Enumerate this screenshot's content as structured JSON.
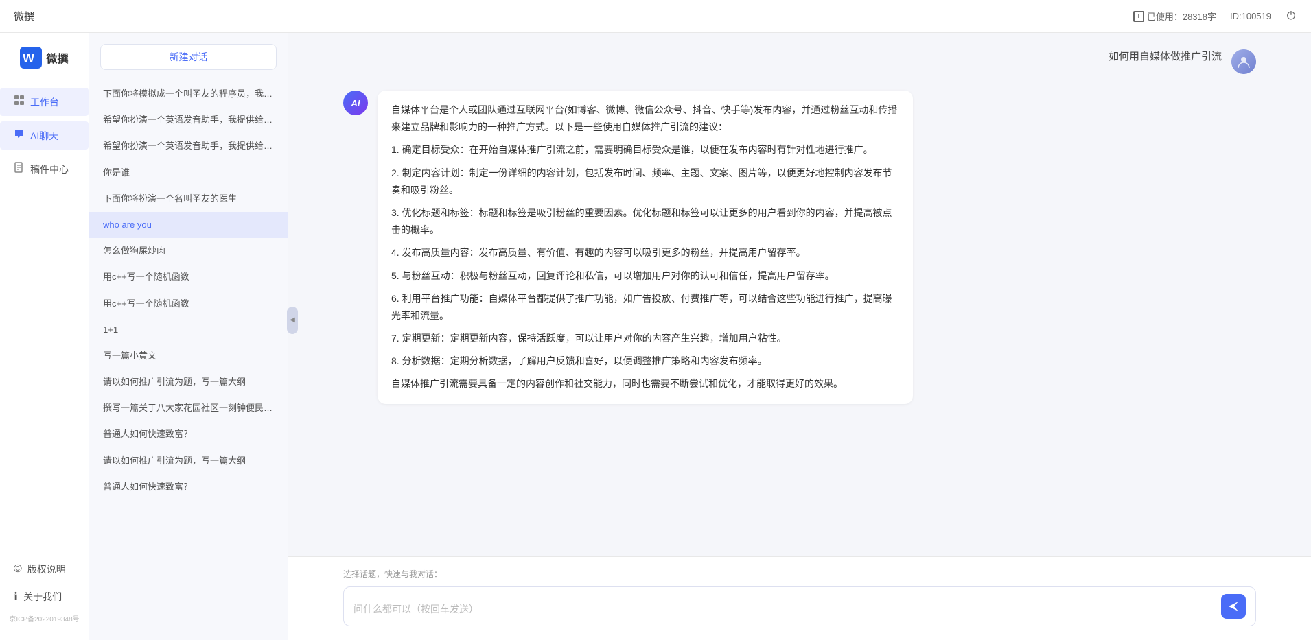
{
  "topbar": {
    "title": "微撰",
    "usage_label": "已使用：28318字",
    "id_label": "ID:100519",
    "usage_icon": "T"
  },
  "logo": {
    "text": "微撰"
  },
  "nav": {
    "items": [
      {
        "id": "workspace",
        "label": "工作台",
        "icon": "⊞"
      },
      {
        "id": "ai-chat",
        "label": "AI聊天",
        "icon": "💬",
        "active": true
      },
      {
        "id": "drafts",
        "label": "稿件中心",
        "icon": "📄"
      }
    ],
    "bottom_items": [
      {
        "id": "copyright",
        "label": "版权说明",
        "icon": "©"
      },
      {
        "id": "about",
        "label": "关于我们",
        "icon": "ℹ"
      }
    ],
    "copyright": "京ICP备2022019348号"
  },
  "sidebar": {
    "new_chat": "新建对话",
    "history": [
      {
        "id": 1,
        "text": "下面你将模拟成一个叫圣友的程序员，我说...",
        "active": false
      },
      {
        "id": 2,
        "text": "希望你扮演一个英语发音助手，我提供给你...",
        "active": false
      },
      {
        "id": 3,
        "text": "希望你扮演一个英语发音助手，我提供给你...",
        "active": false
      },
      {
        "id": 4,
        "text": "你是谁",
        "active": false
      },
      {
        "id": 5,
        "text": "下面你将扮演一个名叫圣友的医生",
        "active": false
      },
      {
        "id": 6,
        "text": "who are you",
        "active": true
      },
      {
        "id": 7,
        "text": "怎么做狗屎炒肉",
        "active": false
      },
      {
        "id": 8,
        "text": "用c++写一个随机函数",
        "active": false
      },
      {
        "id": 9,
        "text": "用c++写一个随机函数",
        "active": false
      },
      {
        "id": 10,
        "text": "1+1=",
        "active": false
      },
      {
        "id": 11,
        "text": "写一篇小黄文",
        "active": false
      },
      {
        "id": 12,
        "text": "请以如何推广引流为题，写一篇大纲",
        "active": false
      },
      {
        "id": 13,
        "text": "撰写一篇关于八大家花园社区一刻钟便民生...",
        "active": false
      },
      {
        "id": 14,
        "text": "普通人如何快速致富？",
        "active": false
      },
      {
        "id": 15,
        "text": "请以如何推广引流为题，写一篇大纲",
        "active": false
      },
      {
        "id": 16,
        "text": "普通人如何快速致富？",
        "active": false
      }
    ]
  },
  "chat": {
    "messages": [
      {
        "id": 1,
        "role": "user",
        "avatar_type": "user",
        "content": "如何用自媒体做推广引流"
      },
      {
        "id": 2,
        "role": "ai",
        "avatar_type": "ai",
        "avatar_label": "AI",
        "content_paragraphs": [
          "自媒体平台是个人或团队通过互联网平台(如博客、微博、微信公众号、抖音、快手等)发布内容，并通过粉丝互动和传播来建立品牌和影响力的一种推广方式。以下是一些使用自媒体推广引流的建议：",
          "1. 确定目标受众：在开始自媒体推广引流之前，需要明确目标受众是谁，以便在发布内容时有针对性地进行推广。",
          "2. 制定内容计划：制定一份详细的内容计划，包括发布时间、频率、主题、文案、图片等，以便更好地控制内容发布节奏和吸引粉丝。",
          "3. 优化标题和标签：标题和标签是吸引粉丝的重要因素。优化标题和标签可以让更多的用户看到你的内容，并提高被点击的概率。",
          "4. 发布高质量内容：发布高质量、有价值、有趣的内容可以吸引更多的粉丝，并提高用户留存率。",
          "5. 与粉丝互动：积极与粉丝互动，回复评论和私信，可以增加用户对你的认可和信任，提高用户留存率。",
          "6. 利用平台推广功能：自媒体平台都提供了推广功能，如广告投放、付费推广等，可以结合这些功能进行推广，提高曝光率和流量。",
          "7. 定期更新：定期更新内容，保持活跃度，可以让用户对你的内容产生兴趣，增加用户粘性。",
          "8. 分析数据：定期分析数据，了解用户反馈和喜好，以便调整推广策略和内容发布频率。",
          "自媒体推广引流需要具备一定的内容创作和社交能力，同时也需要不断尝试和优化，才能取得更好的效果。"
        ]
      }
    ],
    "quick_topics_label": "选择话题，快速与我对话：",
    "input_placeholder": "问什么都可以（按回车发送）"
  }
}
